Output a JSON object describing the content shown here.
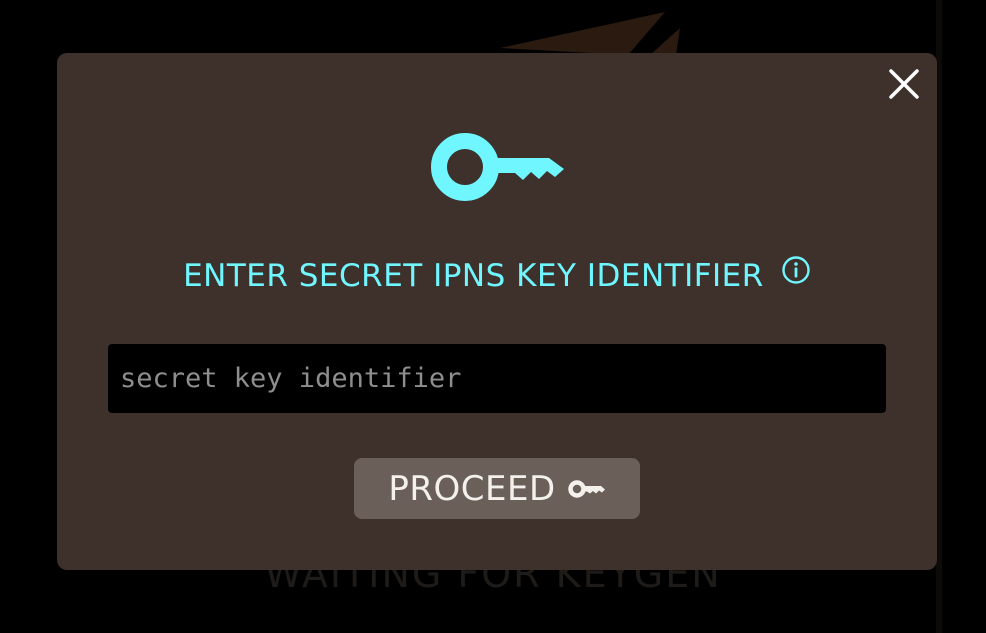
{
  "background": {
    "caption": "WAITING FOR KEYGEN"
  },
  "modal": {
    "title": "ENTER SECRET IPNS KEY IDENTIFIER",
    "close_icon": "close-icon",
    "hero_icon": "key-icon",
    "info_icon": "info-icon",
    "input": {
      "value": "",
      "placeholder": "secret key identifier"
    },
    "proceed_label": "PROCEED",
    "proceed_icon": "key-icon"
  },
  "colors": {
    "accent": "#6ff6ff",
    "modal_bg": "#3e302a",
    "button_bg": "#6a5f59",
    "input_bg": "#000000"
  }
}
